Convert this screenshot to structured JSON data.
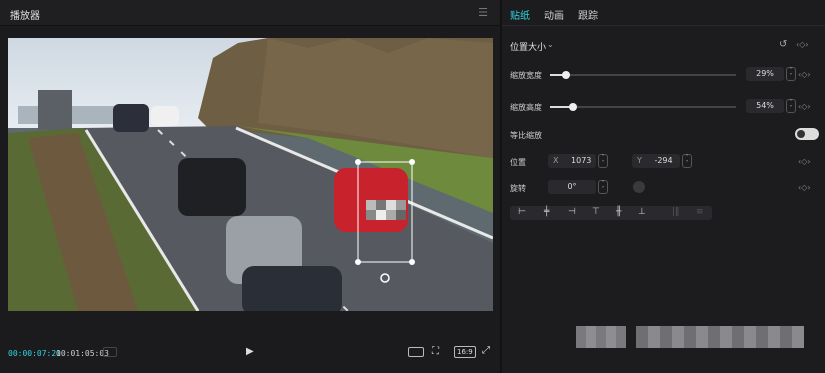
{
  "player": {
    "title": "播放器",
    "menu_icon": "menu-icon",
    "timecode_current": "00:00:07:21",
    "timecode_total": "00:01:05:03",
    "aspect": "16:9"
  },
  "panel": {
    "tabs": [
      {
        "label": "贴纸",
        "active": true
      },
      {
        "label": "动画",
        "active": false
      },
      {
        "label": "跟踪",
        "active": false
      }
    ],
    "section_title": "位置大小",
    "scale_width": {
      "label": "缩放宽度",
      "value": "29%",
      "fraction": 0.29
    },
    "scale_height": {
      "label": "缩放高度",
      "value": "54%",
      "fraction": 0.54
    },
    "uniform_scale": {
      "label": "等比缩放",
      "on": false
    },
    "position": {
      "label": "位置",
      "x_label": "X",
      "x_value": "1073",
      "y_label": "Y",
      "y_value": "-294"
    },
    "rotation": {
      "label": "旋转",
      "value": "0°"
    }
  },
  "colors": {
    "accent": "#2fd5e4",
    "panel_bg": "#1c1c1e"
  }
}
